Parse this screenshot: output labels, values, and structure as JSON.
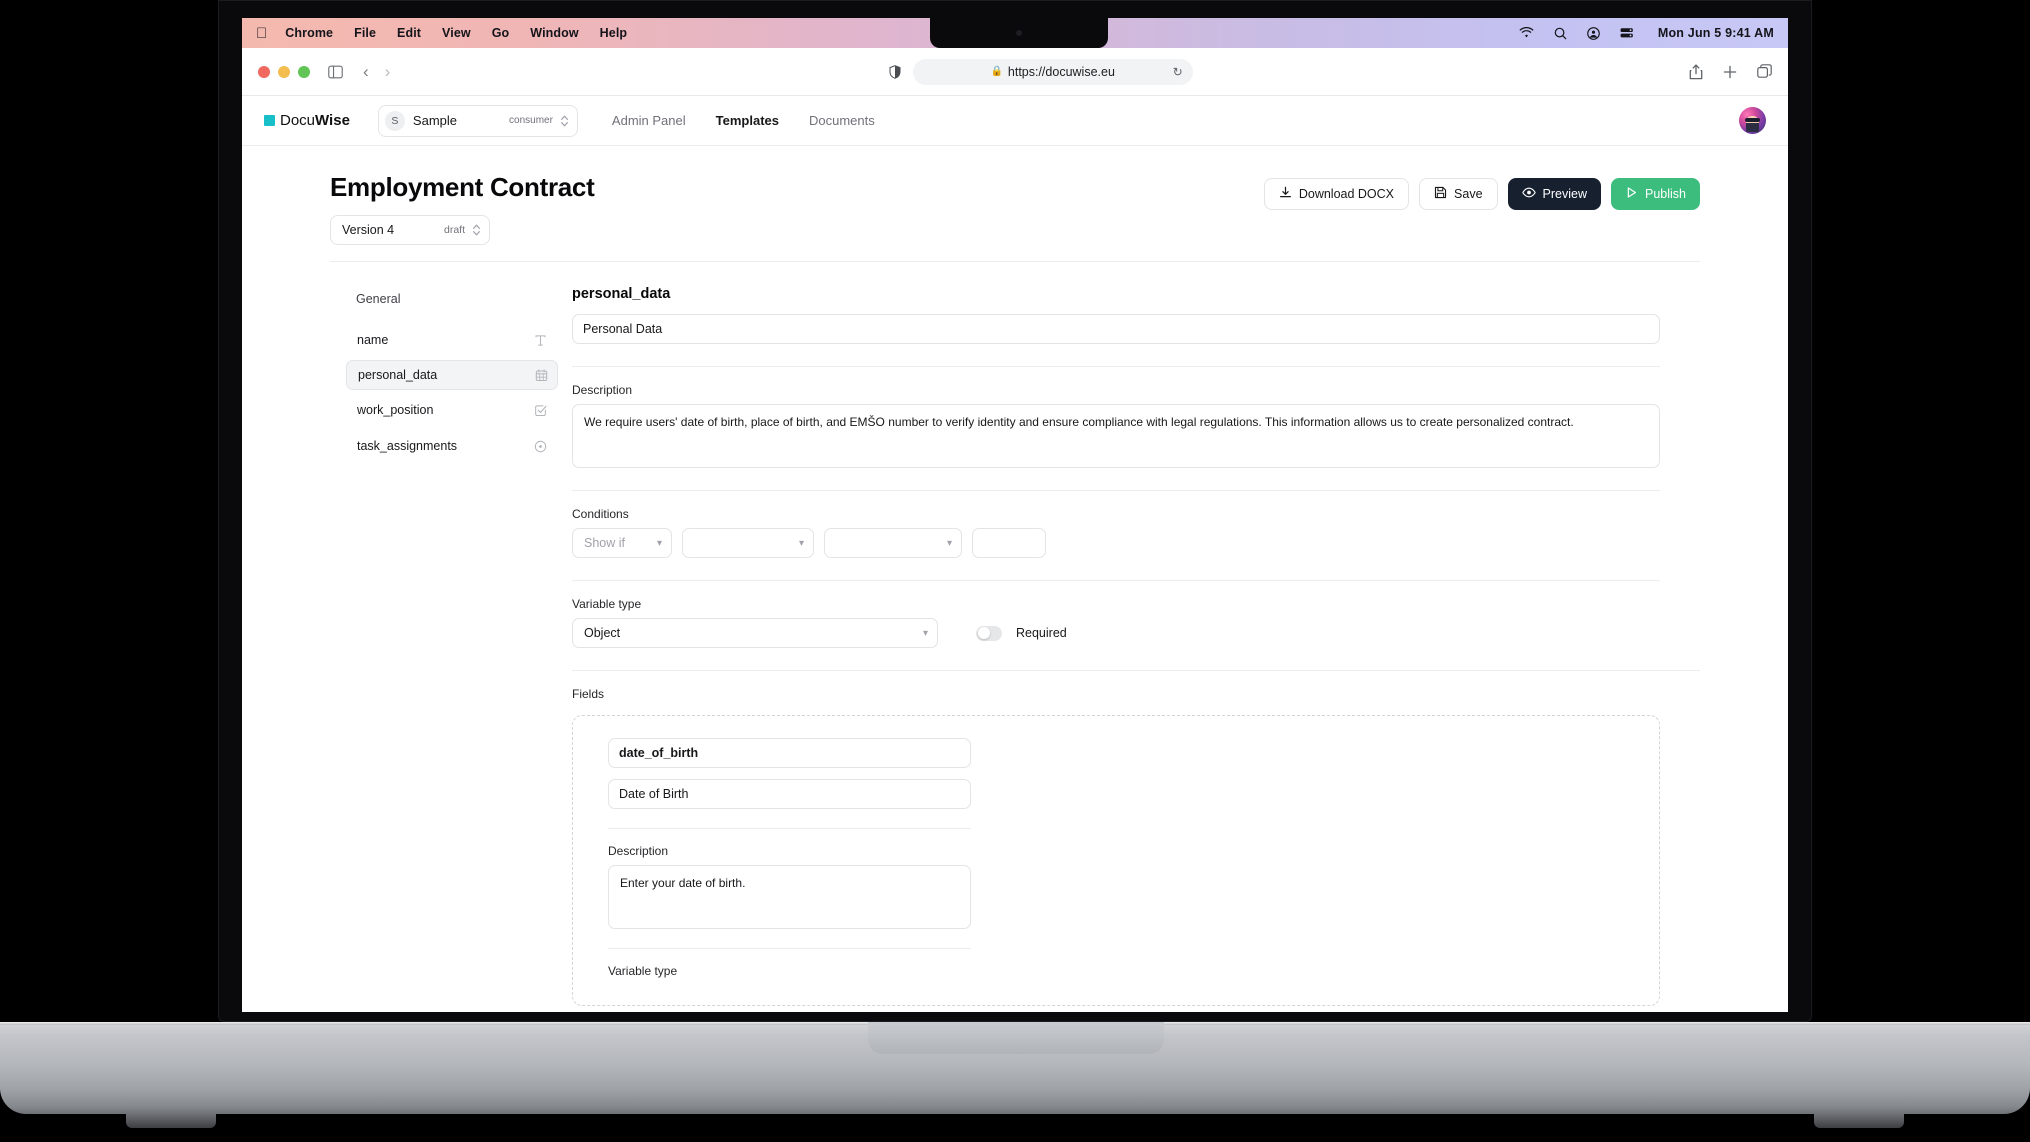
{
  "menubar": {
    "apple_icon": "apple-icon",
    "items": [
      "Chrome",
      "File",
      "Edit",
      "View",
      "Go",
      "Window",
      "Help"
    ],
    "status_icons": [
      "wifi-icon",
      "search-icon",
      "control-center-icon",
      "battery-icon"
    ],
    "clock": "Mon Jun 5  9:41 AM"
  },
  "browser": {
    "traffic_lights": [
      "close-button",
      "minimize-button",
      "zoom-button"
    ],
    "sidebar_icon": "sidebar-toggle-icon",
    "back_icon": "back-arrow-icon",
    "forward_icon": "forward-arrow-icon",
    "shield_icon": "tracking-protection-icon",
    "lock_icon": "lock-icon",
    "url": "https://docuwise.eu",
    "reload_icon": "reload-icon",
    "share_icon": "share-icon",
    "new_tab_icon": "plus-icon",
    "tabs_icon": "tab-overview-icon"
  },
  "app_header": {
    "logo": {
      "mark": "logo-mark",
      "name_light": "Docu",
      "name_bold": "Wise",
      "mark_color": "#17c0c9"
    },
    "org_switcher": {
      "initial": "S",
      "name": "Sample",
      "role": "consumer",
      "chevron": "chevron-updown-icon"
    },
    "nav": [
      {
        "label": "Admin Panel",
        "active": false
      },
      {
        "label": "Templates",
        "active": true
      },
      {
        "label": "Documents",
        "active": false
      }
    ],
    "avatar": "user-avatar"
  },
  "page": {
    "title": "Employment Contract",
    "version_select": {
      "value": "Version 4",
      "status": "draft"
    },
    "actions": [
      {
        "label": "Download DOCX",
        "icon": "download-icon",
        "style": "ghost"
      },
      {
        "label": "Save",
        "icon": "save-icon",
        "style": "ghost"
      },
      {
        "label": "Preview",
        "icon": "eye-icon",
        "style": "dark"
      },
      {
        "label": "Publish",
        "icon": "play-icon",
        "style": "green"
      }
    ]
  },
  "variables_panel": {
    "heading": "General",
    "items": [
      {
        "label": "name",
        "icon": "text-type-icon",
        "selected": false
      },
      {
        "label": "personal_data",
        "icon": "object-grid-icon",
        "selected": true
      },
      {
        "label": "work_position",
        "icon": "checkbox-icon",
        "selected": false
      },
      {
        "label": "task_assignments",
        "icon": "radio-circle-icon",
        "selected": false
      }
    ]
  },
  "editor": {
    "variable_name": "personal_data",
    "display_name_value": "Personal Data",
    "description_label": "Description",
    "description_value": "We require users' date of birth, place of birth, and EMŠO number to verify identity and ensure compliance with legal regulations. This information allows us to create personalized contract.",
    "conditions_label": "Conditions",
    "conditions": [
      {
        "placeholder": "Show if",
        "value": "",
        "chevron": "chevron-down-icon"
      },
      {
        "placeholder": "",
        "value": "",
        "chevron": "chevron-down-icon"
      },
      {
        "placeholder": "",
        "value": "",
        "chevron": "chevron-down-icon"
      },
      {
        "placeholder": "",
        "value": ""
      }
    ],
    "variable_type_label": "Variable type",
    "variable_type_value": "Object",
    "required_label": "Required",
    "required_on": false,
    "fields_label": "Fields",
    "fields": [
      {
        "name_value": "date_of_birth",
        "display_value": "Date of Birth",
        "description_label": "Description",
        "description_value": "Enter your date of birth.",
        "variable_type_label": "Variable type"
      }
    ]
  },
  "colors": {
    "accent_green": "#3dbd7d",
    "dark_button": "#16202f",
    "brand_teal": "#17c0c9",
    "border": "#e4e4e7"
  }
}
